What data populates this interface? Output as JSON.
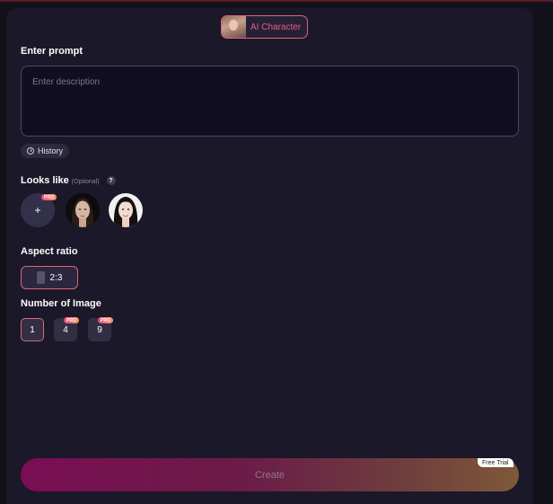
{
  "tab": {
    "label": "AI Character"
  },
  "prompt": {
    "heading": "Enter prompt",
    "placeholder": "Enter description",
    "value": ""
  },
  "history": {
    "label": "History"
  },
  "looks_like": {
    "heading": "Looks like",
    "optional": "(Optional)",
    "help": "?",
    "add_label": "+",
    "pro_badge": "PRO"
  },
  "aspect_ratio": {
    "heading": "Aspect ratio",
    "value": "2:3"
  },
  "number_of_image": {
    "heading": "Number of Image",
    "options": [
      {
        "label": "1",
        "selected": true,
        "pro": false
      },
      {
        "label": "4",
        "selected": false,
        "pro": true
      },
      {
        "label": "9",
        "selected": false,
        "pro": true
      }
    ],
    "pro_badge": "PRO"
  },
  "create": {
    "label": "Create",
    "badge": "Free Trial"
  },
  "colors": {
    "accent": "#d9677a",
    "panel": "#1b1829",
    "background": "#121019"
  }
}
